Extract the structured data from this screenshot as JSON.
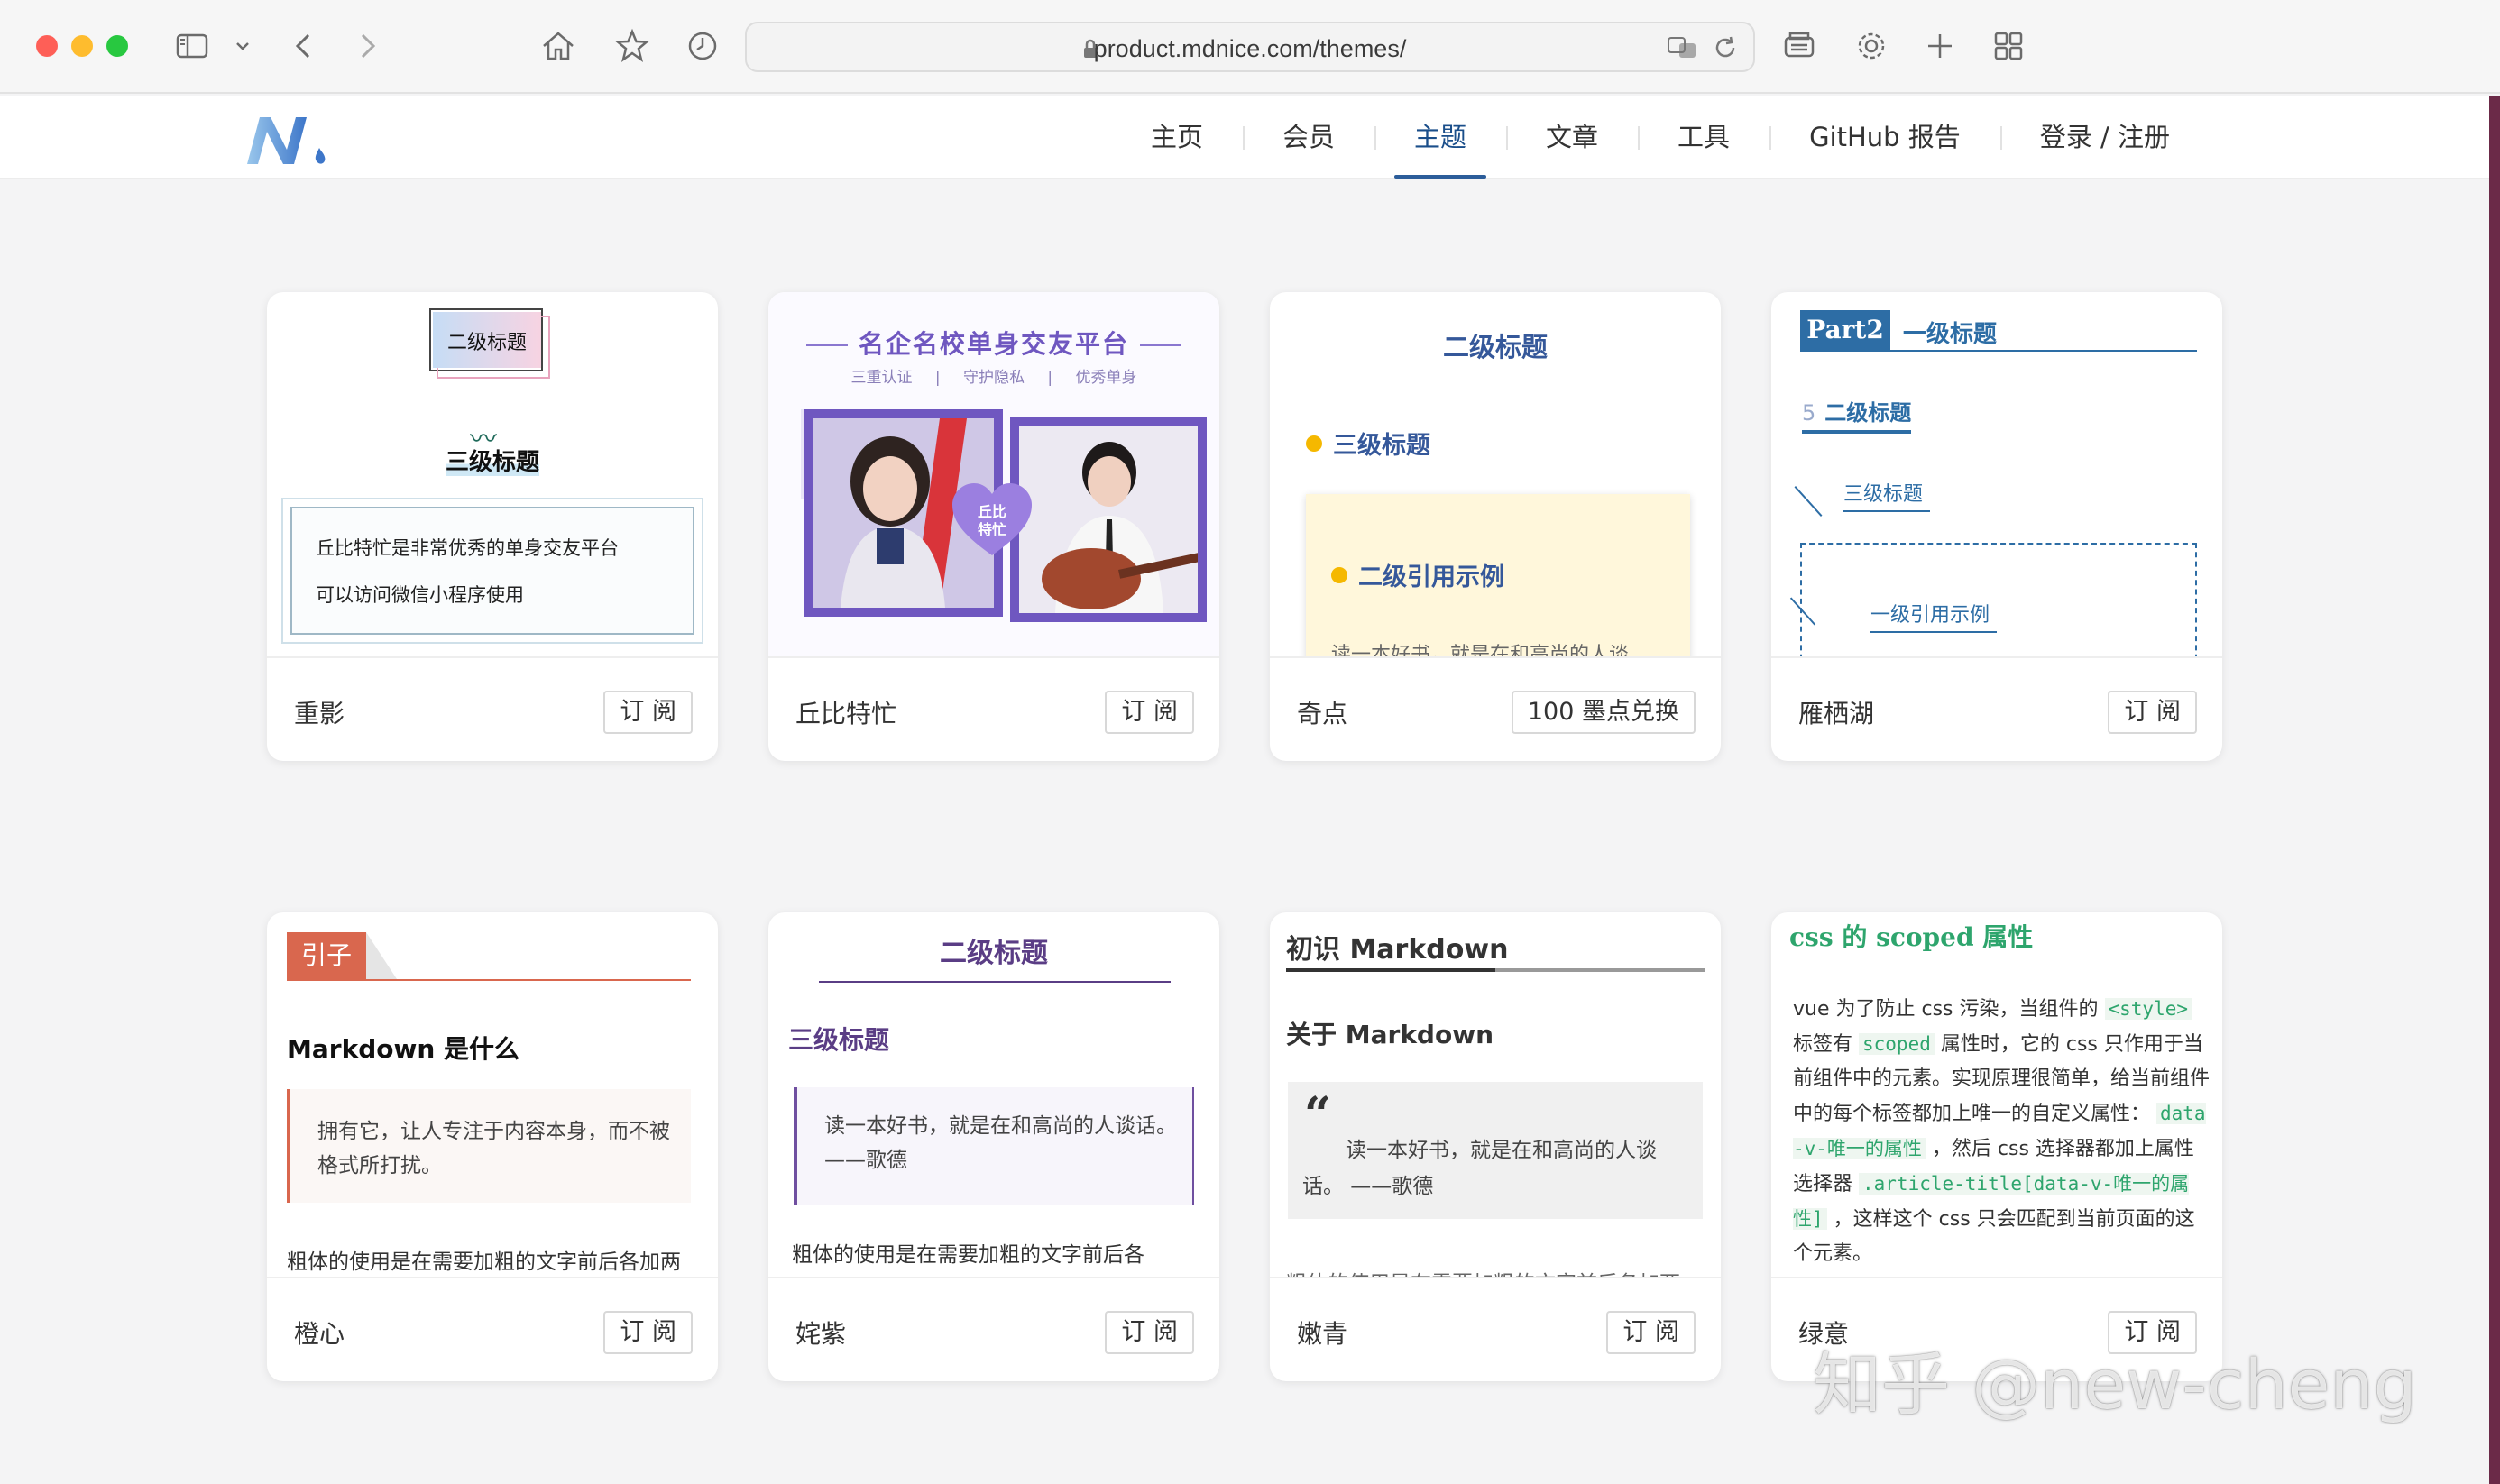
{
  "browser": {
    "url": "product.mdnice.com/themes/"
  },
  "nav": {
    "items": [
      "主页",
      "会员",
      "主题",
      "文章",
      "工具",
      "GitHub 报告",
      "登录 / 注册"
    ],
    "active_index": 2
  },
  "cards": [
    {
      "name": "重影",
      "button": "订 阅",
      "preview": {
        "h2": "二级标题",
        "h3": "三级标题",
        "quote_line1": "丘比特忙是非常优秀的单身交友平台",
        "quote_line2": "可以访问微信小程序使用"
      }
    },
    {
      "name": "丘比特忙",
      "button": "订 阅",
      "preview": {
        "title": "名企名校单身交友平台",
        "subtitle": "三重认证 | 守护隐私 | 优秀单身",
        "heart_line1": "丘比",
        "heart_line2": "特忙"
      }
    },
    {
      "name": "奇点",
      "button": "100 墨点兑换",
      "preview": {
        "h2": "二级标题",
        "h3": "三级标题",
        "quote_title": "二级引用示例",
        "quote_text": "读一本好书，就是在和高尚的人谈"
      }
    },
    {
      "name": "雁栖湖",
      "button": "订 阅",
      "preview": {
        "part": "Part2",
        "h1": "一级标题",
        "h2_num": "5",
        "h2": "二级标题",
        "h3": "三级标题",
        "quote": "一级引用示例"
      }
    },
    {
      "name": "橙心",
      "button": "订 阅",
      "preview": {
        "tag": "引子",
        "heading": "Markdown 是什么",
        "quote": "拥有它，让人专注于内容本身，而不被格式所打扰。",
        "footer_text": "粗体的使用是在需要加粗的文字前后各加两"
      }
    },
    {
      "name": "姹紫",
      "button": "订 阅",
      "preview": {
        "h2": "二级标题",
        "h3": "三级标题",
        "quote": "读一本好书，就是在和高尚的人谈话。 ——歌德",
        "footer_text": "粗体的使用是在需要加粗的文字前后各"
      }
    },
    {
      "name": "嫩青",
      "button": "订 阅",
      "preview": {
        "h2": "初识 Markdown",
        "h3": "关于 Markdown",
        "quote_mark": "“",
        "quote": "读一本好书，就是在和高尚的人谈话。 ——歌德",
        "footer_text": "粗体的使用是在需要加粗的文字前后各加两"
      }
    },
    {
      "name": "绿意",
      "button": "订 阅",
      "preview": {
        "heading": "css 的 scoped 属性",
        "t1": "vue 为了防止 css 污染，当组件的 ",
        "c1": "<style>",
        "t2": " 标签有 ",
        "c2": "scoped",
        "t3": " 属性时，它的 css 只作用于当前组件中的元素。实现原理很简单，给当前组件中的每个标签都加上唯一的自定义属性： ",
        "c3": "data-v-唯一的属性",
        "t4": " ，然后 css 选择器都加上属性选择器 ",
        "c4": ".article-title[data-v-唯一的属性]",
        "t5": " ，这样这个 css 只会匹配到当前页面的这个元素。"
      }
    }
  ],
  "watermark": "知乎 @new-cheng",
  "colors": {
    "nav_active": "#2c5d9a",
    "c2_purple": "#6f57c0",
    "c3_blue": "#35589a",
    "c4_blue": "#2d6da5",
    "c5_orange": "#d9674e",
    "c6_purple": "#5a3d85",
    "c8_green": "#2ea56d"
  }
}
